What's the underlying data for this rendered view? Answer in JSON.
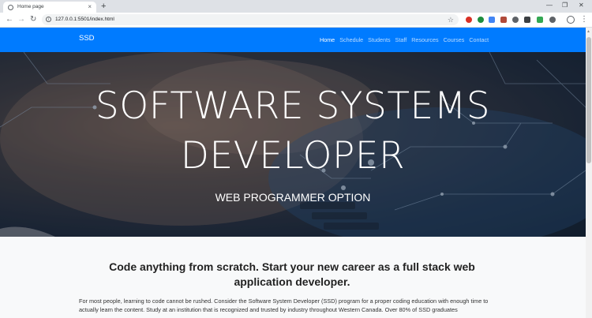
{
  "browser": {
    "tab_title": "Home page",
    "tab_close": "×",
    "new_tab": "+",
    "url": "127.0.0.1:5501/index.html",
    "window_minimize": "—",
    "window_restore": "❐",
    "window_close": "✕",
    "back": "←",
    "forward": "→",
    "reload": "↻",
    "info": "i",
    "star": "☆",
    "menu": "⋮"
  },
  "navbar": {
    "brand": "SSD",
    "links": [
      {
        "label": "Home",
        "active": true
      },
      {
        "label": "Schedule"
      },
      {
        "label": "Students"
      },
      {
        "label": "Staff"
      },
      {
        "label": "Resources"
      },
      {
        "label": "Courses"
      },
      {
        "label": "Contact"
      }
    ],
    "color": "#007bff"
  },
  "hero": {
    "title_line1": "SOFTWARE SYSTEMS",
    "title_line2": "DEVELOPER",
    "subtitle": "WEB PROGRAMMER OPTION"
  },
  "content": {
    "headline": "Code anything from scratch. Start your new career as a full stack web application developer.",
    "body": "For most people, learning to code cannot be rushed. Consider the Software System Developer (SSD) program for a proper coding education with enough time to actually learn the content. Study at an institution that is recognized and trusted by industry throughout Western Canada. Over 80% of SSD graduates"
  }
}
